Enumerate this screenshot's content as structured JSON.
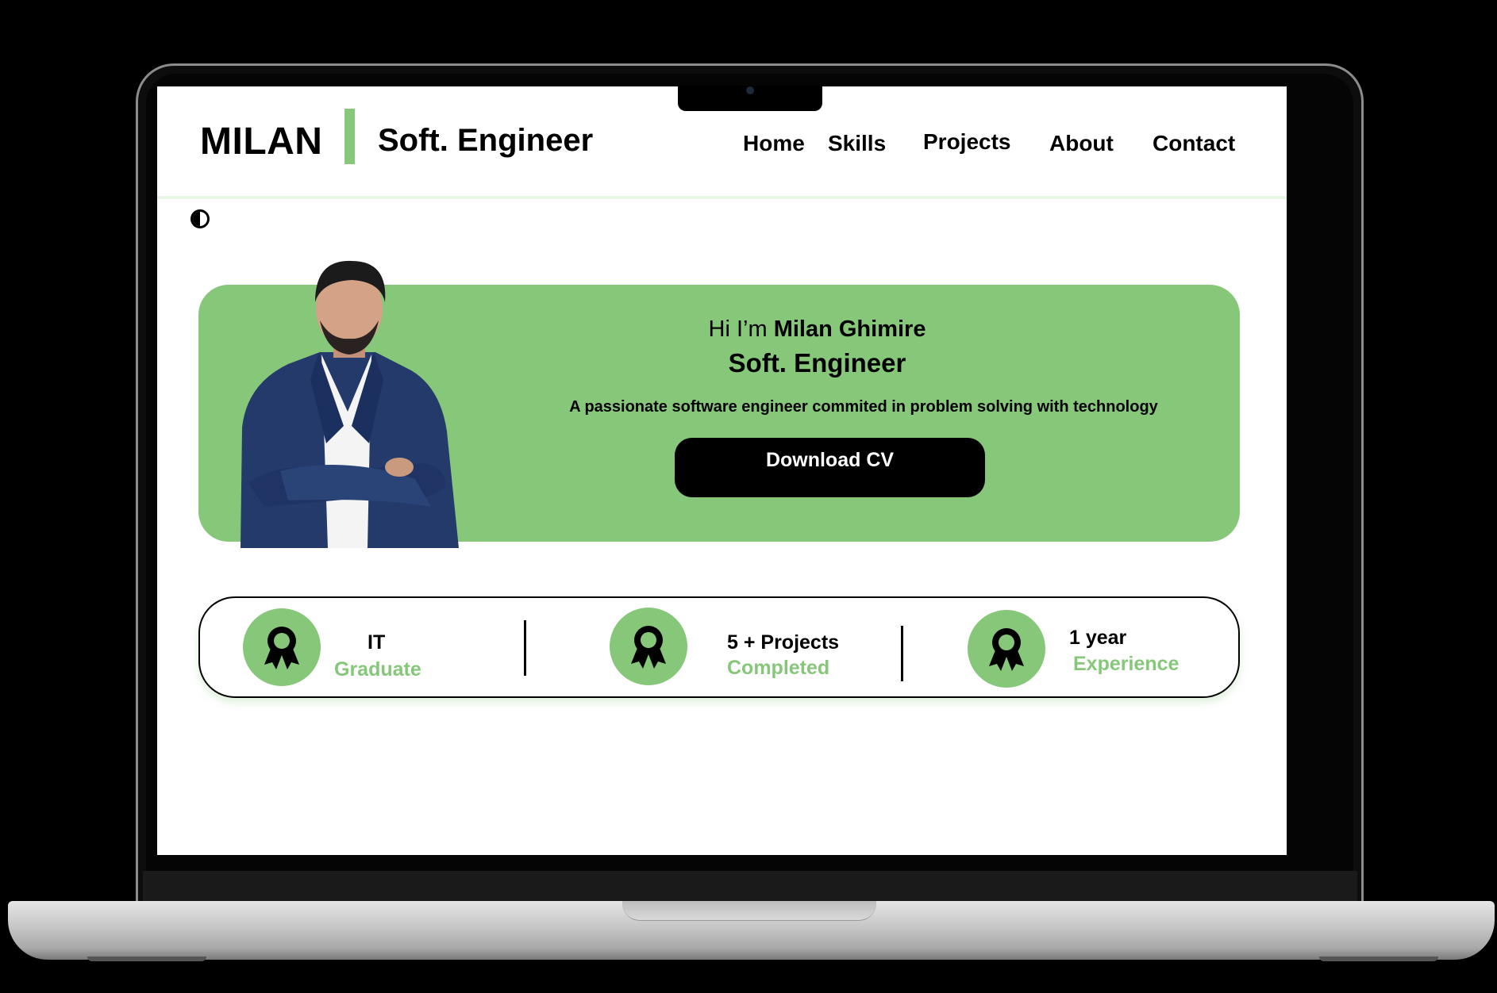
{
  "header": {
    "brand": "MILAN",
    "role": "Soft. Engineer",
    "nav": [
      "Home",
      "Skills",
      "Projects",
      "About",
      "Contact"
    ]
  },
  "hero": {
    "greeting_prefix": "Hi I’m ",
    "name": "Milan Ghimire",
    "title": "Soft. Engineer",
    "description": "A passionate software engineer commited in problem solving with technology",
    "button": "Download CV"
  },
  "stats": [
    {
      "top": "IT",
      "bottom": "Graduate"
    },
    {
      "top": "5 + Projects",
      "bottom": "Completed"
    },
    {
      "top": "1 year",
      "bottom": "Experience"
    }
  ],
  "colors": {
    "accent": "#86c77a",
    "text": "#000000",
    "background": "#ffffff"
  },
  "icons": {
    "theme_toggle": "contrast-icon",
    "stat": "award-ribbon-icon"
  }
}
